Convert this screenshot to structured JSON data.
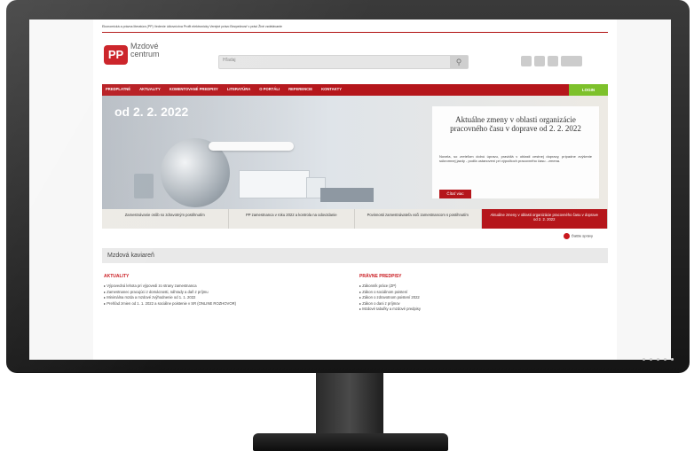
{
  "site": {
    "top_links": "Ekonomická a právna literatúra (PP)   Vedenie účtovníctva   Profit elektronicky   Verejné právo   Bezpečnosť v práci   Živé vzdelávanie",
    "logo_text": "PP",
    "brand_line1": "Mzdové",
    "brand_line2": "centrum",
    "search_placeholder": "Hľadaj",
    "nav_items": [
      "PREDPLATNÉ",
      "AKTUALITY",
      "KOMENTOVANÉ PREDPISY",
      "LITERATÚRA",
      "O PORTÁLI",
      "REFERENCIE",
      "KONTAKTY"
    ],
    "login_label": "LOGIN",
    "banner": {
      "date": "od 2. 2. 2022",
      "title": "Aktuálne zmeny v oblasti organizácie pracovného času v doprave od 2. 2. 2022",
      "text": "Novela, so zreteľom dolnú úpravu, pravidlá v oblasti cestnej dopravy, prípadne zvýšenie súkromnej jazdy - podľa ustanovení pri výpočtoch pracovného času - zmena.",
      "button": "Čítať viac"
    },
    "tabs": [
      "Zamestnávanie osôb so zdravotným postihnutím",
      "PP zamestnanca v roku 2022 a kontrola na odovzdanie",
      "Povinnosti zamestnávateľa voči zamestnancom s postihnutím",
      "Aktuálne zmeny v oblasti organizácie pracovného času v doprave od 2. 2. 2022"
    ],
    "active_tab": 3,
    "more_label": "Ďalšie správy",
    "section_title": "Mzdová kaviareň",
    "news": {
      "title": "AKTUALITY",
      "items": [
        "Výpovedná lehota pri výpovedi zo strany zamestnanca",
        "Zamestnanec pracujúci z domácnosti, náhrady a daň z príjmu",
        "Minimálna mzda a mzdové zvýhodnenie od 1. 1. 2022",
        "Prehľad zmien od 1. 1. 2022 a sociálne poistenie v SR (ONLINE ROZHOVOR)"
      ]
    },
    "laws": {
      "title": "PRÁVNE PREDPISY",
      "items": [
        "Zákonník práce (ZP)",
        "Zákon o sociálnom poistení",
        "Zákon o zdravotnom poistení 2022",
        "Zákon o dani z príjmov",
        "Mzdové tabuľky a mzdové predpisy"
      ]
    }
  }
}
